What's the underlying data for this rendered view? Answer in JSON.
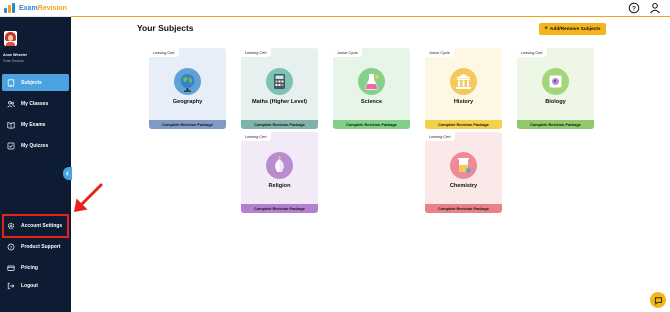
{
  "brand": {
    "part1": "Exam",
    "part2": "Revision"
  },
  "user": {
    "name": "Anne Wheeler",
    "role": "Exam Revision"
  },
  "nav": {
    "subjects": "Subjects",
    "classes": "My Classes",
    "exams": "My Exams",
    "quizzes": "My Quizzes",
    "account_settings": "Account Settings",
    "product_support": "Product Support",
    "pricing": "Pricing",
    "logout": "Logout"
  },
  "page": {
    "title": "Your Subjects",
    "add_button": "Add/Remove Subjects",
    "add_symbol": "+"
  },
  "subjects": [
    {
      "level": "Leaving Cert",
      "name": "Geography",
      "footer": "Complete Revision Package",
      "icon": "globe-icon",
      "bg": "#e8eef8",
      "footer_color": "#7f9bc4",
      "circle": "#5fa3d6"
    },
    {
      "level": "Leaving Cert",
      "name": "Maths (Higher Level)",
      "footer": "Complete Revision Package",
      "icon": "calculator-icon",
      "bg": "#e6f1ef",
      "footer_color": "#7fb3aa",
      "circle": "#7fc1b3"
    },
    {
      "level": "Junior Cycle",
      "name": "Science",
      "footer": "Complete Revision Package",
      "icon": "flask-icon",
      "bg": "#e7f5e8",
      "footer_color": "#7fcf86",
      "circle": "#83d18a"
    },
    {
      "level": "Junior Cycle",
      "name": "History",
      "footer": "Complete Revision Package",
      "icon": "column-icon",
      "bg": "#fdf7e3",
      "footer_color": "#f2d24b",
      "circle": "#f4c85a"
    },
    {
      "level": "Leaving Cert",
      "name": "Biology",
      "footer": "Complete Revision Package",
      "icon": "cell-icon",
      "bg": "#eef6e6",
      "footer_color": "#8fc96a",
      "circle": "#a3d67c"
    },
    {
      "level": "Leaving Cert",
      "name": "Religion",
      "footer": "Complete Revision Package",
      "icon": "hands-icon",
      "bg": "#f2eaf6",
      "footer_color": "#b47fcf",
      "circle": "#b98bd1"
    },
    {
      "level": "Leaving Cert",
      "name": "Chemistry",
      "footer": "Complete Revision Package",
      "icon": "beaker-icon",
      "bg": "#fbe9ea",
      "footer_color": "#e9808a",
      "circle": "#ee8c95"
    }
  ],
  "colors": {
    "sidebar": "#0d1b33",
    "accent": "#4aa3df",
    "brand_yellow": "#f3b51b",
    "highlight_red": "#e5231b"
  }
}
